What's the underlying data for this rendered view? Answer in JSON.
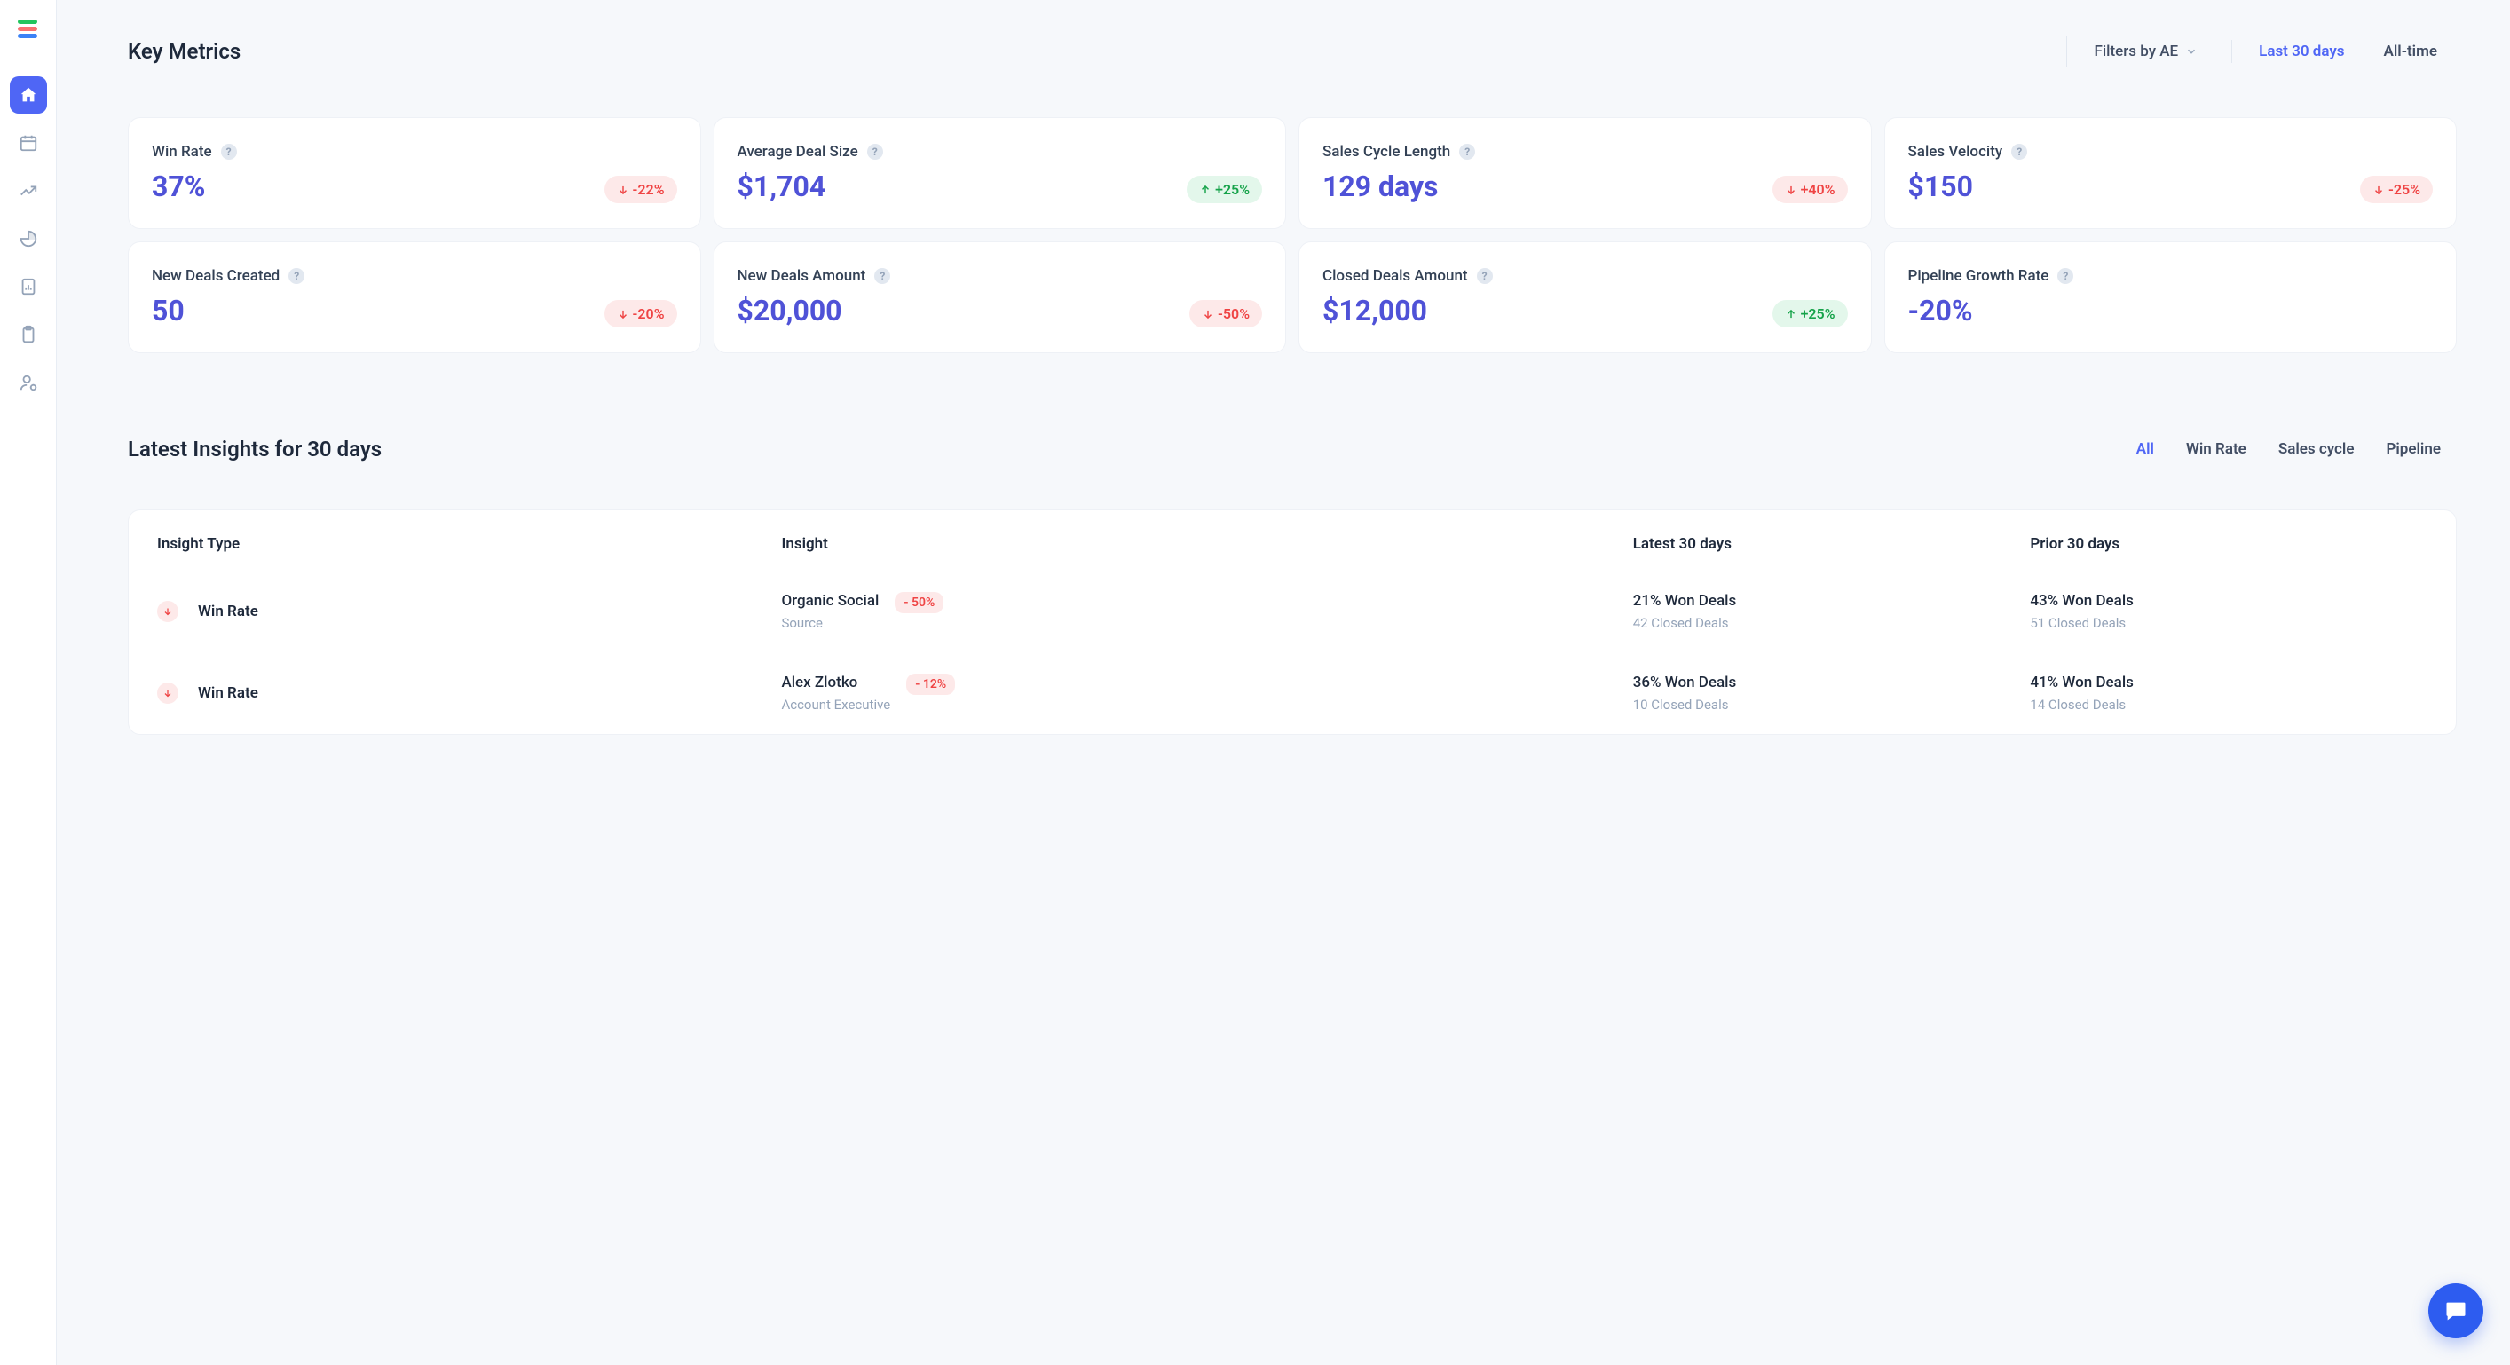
{
  "header": {
    "title": "Key Metrics",
    "filter_label": "Filters by AE",
    "range_tabs": [
      "Last 30 days",
      "All-time"
    ],
    "active_range": 0
  },
  "metrics": [
    {
      "label": "Win Rate",
      "value": "37%",
      "delta": "-22%",
      "dir": "down"
    },
    {
      "label": "Average Deal Size",
      "value": "$1,704",
      "delta": "+25%",
      "dir": "up"
    },
    {
      "label": "Sales Cycle Length",
      "value": "129 days",
      "delta": "+40%",
      "dir": "down"
    },
    {
      "label": "Sales Velocity",
      "value": "$150",
      "delta": "-25%",
      "dir": "down"
    },
    {
      "label": "New Deals Created",
      "value": "50",
      "delta": "-20%",
      "dir": "down"
    },
    {
      "label": "New Deals Amount",
      "value": "$20,000",
      "delta": "-50%",
      "dir": "down"
    },
    {
      "label": "Closed Deals Amount",
      "value": "$12,000",
      "delta": "+25%",
      "dir": "up"
    },
    {
      "label": "Pipeline Growth Rate",
      "value": "-20%",
      "delta": "",
      "dir": ""
    }
  ],
  "insights": {
    "title": "Latest Insights for 30 days",
    "tabs": [
      "All",
      "Win Rate",
      "Sales cycle",
      "Pipeline"
    ],
    "active_tab": 0,
    "columns": [
      "Insight Type",
      "Insight",
      "Latest 30 days",
      "Prior 30 days"
    ],
    "rows": [
      {
        "type": "Win Rate",
        "dir": "down",
        "insight_title": "Organic Social",
        "insight_sub": "Source",
        "badge": "- 50%",
        "latest_main": "21% Won Deals",
        "latest_sub": "42 Closed Deals",
        "prior_main": "43% Won Deals",
        "prior_sub": "51 Closed Deals"
      },
      {
        "type": "Win Rate",
        "dir": "down",
        "insight_title": "Alex Zlotko",
        "insight_sub": "Account Executive",
        "badge": "- 12%",
        "latest_main": "36% Won Deals",
        "latest_sub": "10 Closed Deals",
        "prior_main": "41% Won Deals",
        "prior_sub": "14 Closed Deals"
      }
    ]
  }
}
